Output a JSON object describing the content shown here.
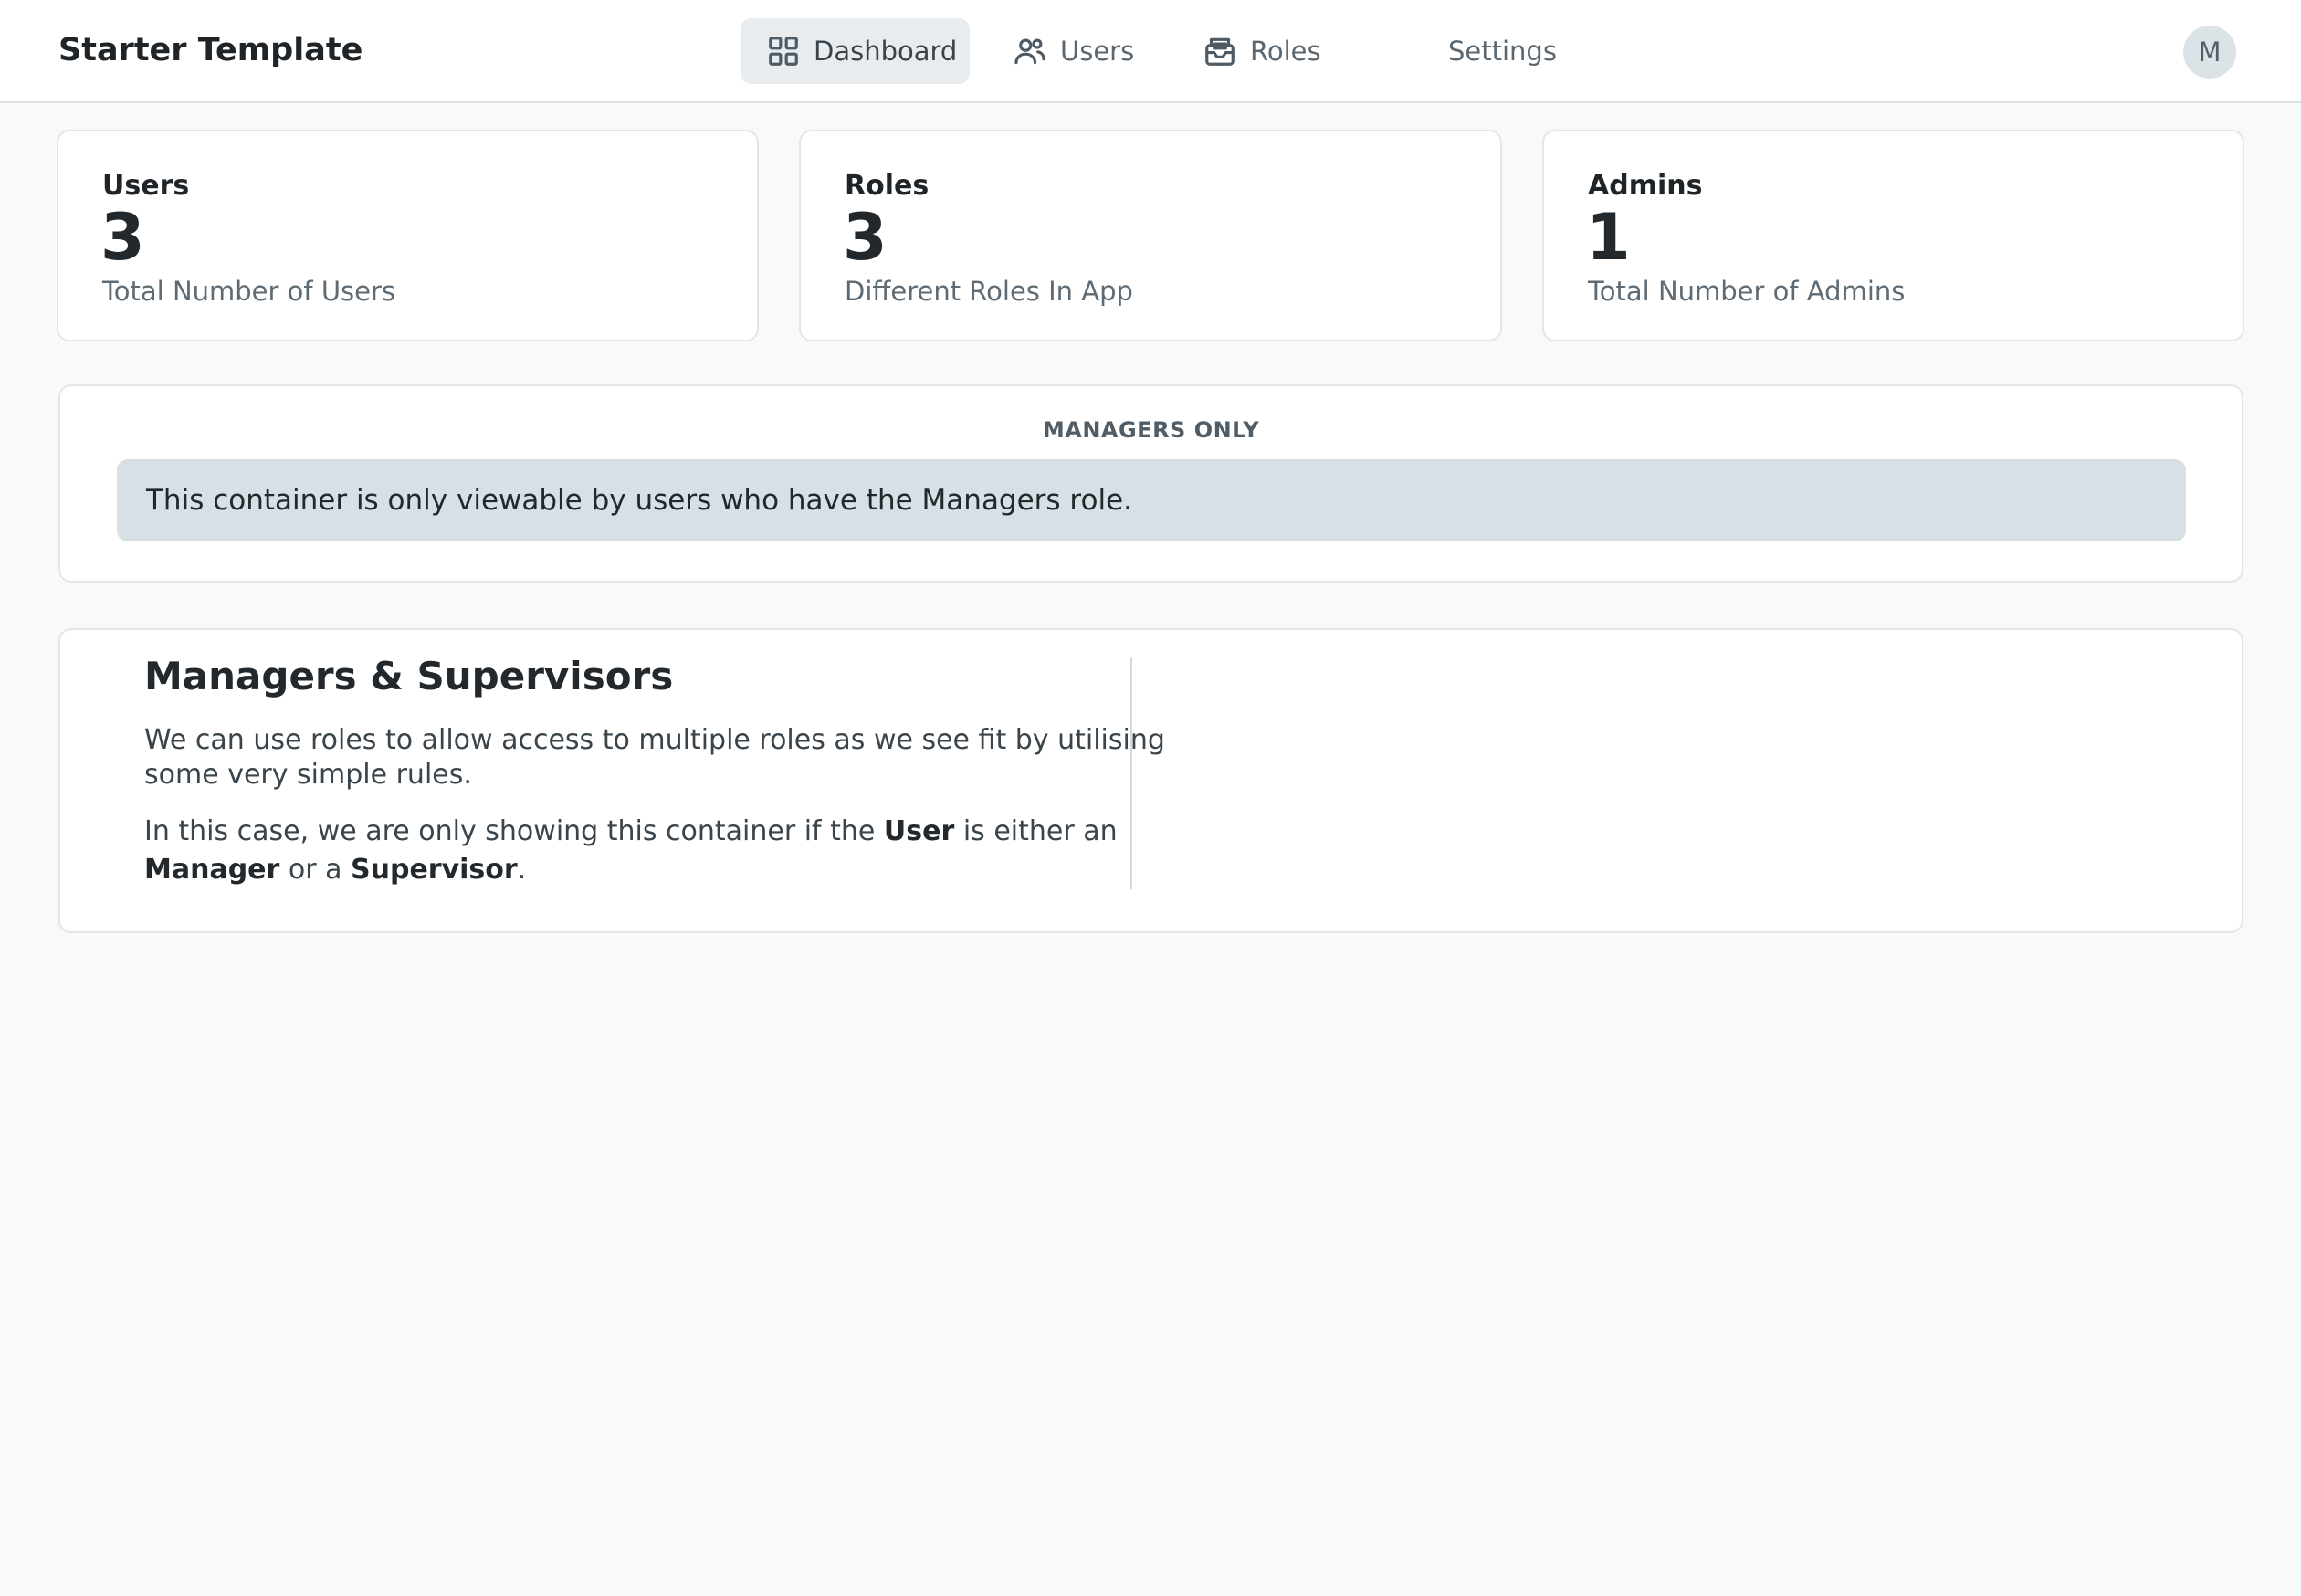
{
  "app": {
    "title": "Starter Template"
  },
  "nav": {
    "items": [
      {
        "label": "Dashboard",
        "icon": "dashboard-grid-icon",
        "active": true
      },
      {
        "label": "Users",
        "icon": "users-icon",
        "active": false
      },
      {
        "label": "Roles",
        "icon": "roles-inbox-icon",
        "active": false
      },
      {
        "label": "Settings",
        "icon": "",
        "active": false
      }
    ]
  },
  "user": {
    "avatar_initial": "M"
  },
  "stats": [
    {
      "title": "Users",
      "value": "3",
      "description": "Total Number of Users"
    },
    {
      "title": "Roles",
      "value": "3",
      "description": "Different Roles In App"
    },
    {
      "title": "Admins",
      "value": "1",
      "description": "Total Number of Admins"
    }
  ],
  "managers_only": {
    "label": "MANAGERS ONLY",
    "message": "This container is only viewable by users who have the Managers role."
  },
  "managers_supervisors": {
    "title": "Managers & Supervisors",
    "paragraph1": "We can use roles to allow access to multiple roles as we see fit by utilising some very simple rules.",
    "paragraph2": {
      "part1": "In this case, we are only showing this container if the ",
      "bold1": "User",
      "part2": " is either an ",
      "bold2": "Manager",
      "part3": " or a ",
      "bold3": "Supervisor",
      "part4": "."
    }
  },
  "colors": {
    "background": "#f8f9f9",
    "card": "#ffffff",
    "nav_active": "#e8ecee",
    "notice": "#d7e0e5",
    "avatar": "#dbe3e7"
  }
}
